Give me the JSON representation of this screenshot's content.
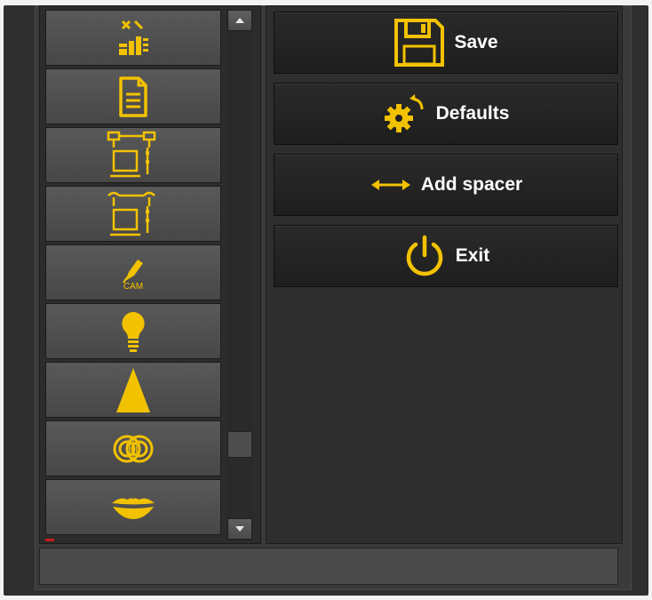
{
  "colors": {
    "accent": "#f2c200",
    "panel_bg": "#2e2e2e",
    "button_bg": "#1f1f1f",
    "text": "#ffffff"
  },
  "toolbar": {
    "items": [
      {
        "icon": "layout-icon"
      },
      {
        "icon": "document-icon"
      },
      {
        "icon": "workstation-network-icon"
      },
      {
        "icon": "workstation-link-icon"
      },
      {
        "icon": "cam-tool-icon",
        "label": "CAM"
      },
      {
        "icon": "light-bulb-icon"
      },
      {
        "icon": "cone-icon"
      },
      {
        "icon": "overlapping-circles-icon"
      },
      {
        "icon": "lips-icon"
      }
    ]
  },
  "actions": {
    "save": {
      "label": "Save",
      "icon": "save-icon"
    },
    "defaults": {
      "label": "Defaults",
      "icon": "gear-reset-icon"
    },
    "add_spacer": {
      "label": "Add spacer",
      "icon": "horizontal-arrows-icon"
    },
    "exit": {
      "label": "Exit",
      "icon": "power-icon"
    }
  }
}
